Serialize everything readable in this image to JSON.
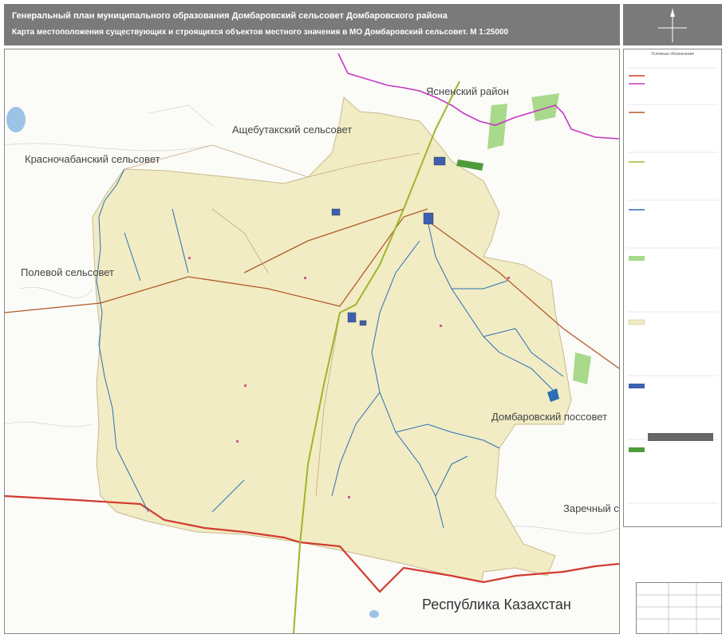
{
  "header": {
    "title": "Генеральный план муниципального образования Домбаровский сельсовет Домбаровского района",
    "subtitle": "Карта местоположения существующих и строящихся объектов местного значения в МО Домбаровский сельсовет. М 1:25000"
  },
  "map": {
    "labels": {
      "yasny": "Ясненский район",
      "ashchebutak": "Ащебутакский сельсовет",
      "krasnochaban": "Красночабанский сельсовет",
      "polevoy": "Полевой сельсовет",
      "dombarovsky": "Домбаровский поссовет",
      "zarechny": "Заречный сельсовет",
      "kazakhstan": "Республика Казахстан"
    },
    "colors": {
      "territory": "#f1ecc4",
      "border_state": "#d23b2f",
      "river": "#2a6fb5",
      "road": "#b45a2a",
      "railway": "#9fb52a",
      "district_border": "#c436c4",
      "forest": "#a9d98a"
    }
  },
  "legend": {
    "title": "Условные обозначения"
  }
}
